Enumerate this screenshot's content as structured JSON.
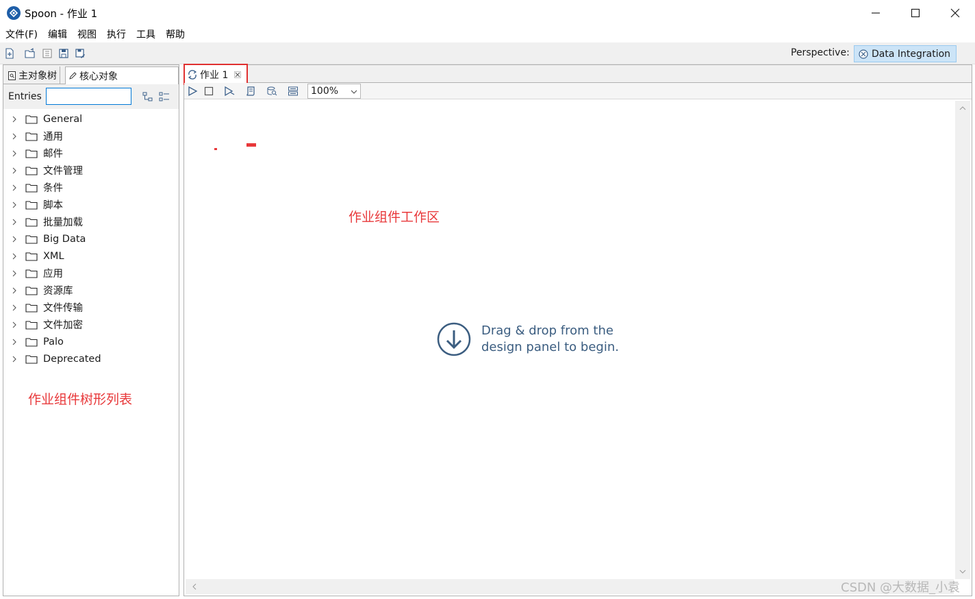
{
  "window": {
    "title": "Spoon - 作业 1"
  },
  "menu": [
    "文件(F)",
    "编辑",
    "视图",
    "执行",
    "工具",
    "帮助"
  ],
  "toolbar": {
    "perspective_label": "Perspective:",
    "perspective_value": "Data Integration"
  },
  "left_panel": {
    "tabs": [
      "主对象树",
      "核心对象"
    ],
    "entries_label": "Entries",
    "search_value": "",
    "tree": [
      "General",
      "通用",
      "邮件",
      "文件管理",
      "条件",
      "脚本",
      "批量加载",
      "Big Data",
      "XML",
      "应用",
      "资源库",
      "文件传输",
      "文件加密",
      "Palo",
      "Deprecated"
    ],
    "annotation": "作业组件树形列表"
  },
  "editor": {
    "tab_label": "作业 1",
    "zoom": "100%",
    "annotation": "作业组件工作区",
    "hint_line1": "Drag & drop from the",
    "hint_line2": "design panel to begin."
  },
  "watermark": "CSDN @大数据_小袁",
  "colors": {
    "annotation": "#e8383a",
    "hint": "#3b5d80",
    "perspective_bg": "#cce4f7"
  }
}
